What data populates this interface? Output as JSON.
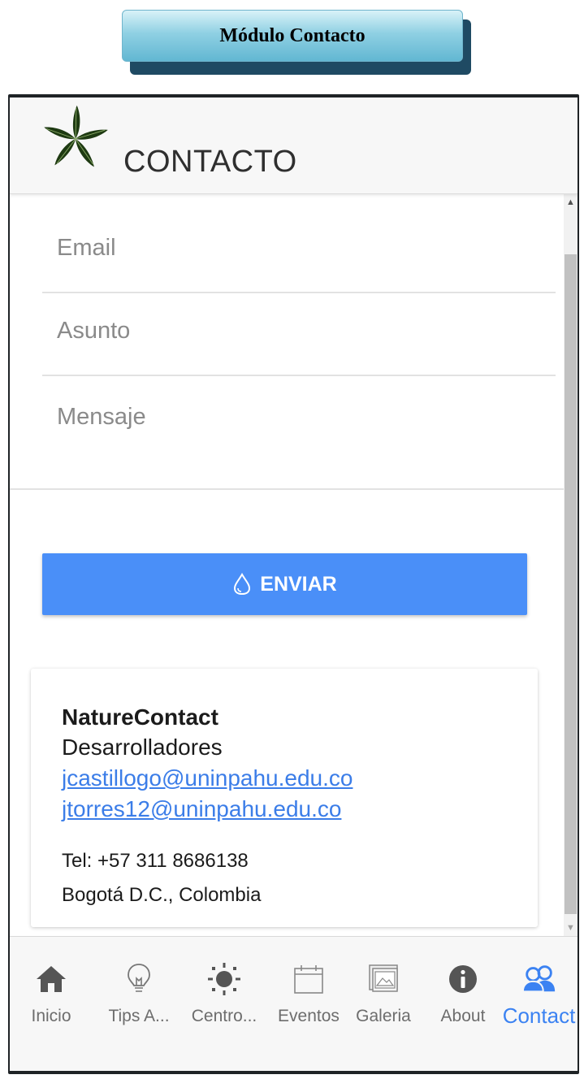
{
  "banner": {
    "title": "Módulo Contacto"
  },
  "header": {
    "title": "CONTACTO",
    "logo_icon": "leaf-star-logo"
  },
  "form": {
    "email_placeholder": "Email",
    "subject_placeholder": "Asunto",
    "message_placeholder": "Mensaje",
    "send_label": "ENVIAR",
    "send_icon": "water-drop-icon",
    "accent": "#4a8ff8"
  },
  "contact_card": {
    "name": "NatureContact",
    "role": "Desarrolladores",
    "emails": [
      "jcastillogo@uninpahu.edu.co",
      "jtorres12@uninpahu.edu.co"
    ],
    "phone": "Tel: +57 311 8686138",
    "city": "Bogotá D.C., Colombia"
  },
  "tabs": [
    {
      "label": "Inicio",
      "icon": "home-icon",
      "active": false
    },
    {
      "label": "Tips A...",
      "icon": "lightbulb-icon",
      "active": false
    },
    {
      "label": "Centro...",
      "icon": "sun-icon",
      "active": false
    },
    {
      "label": "Eventos",
      "icon": "calendar-icon",
      "active": false
    },
    {
      "label": "Galeria",
      "icon": "gallery-icon",
      "active": false
    },
    {
      "label": "About",
      "icon": "info-icon",
      "active": false
    },
    {
      "label": "Contact",
      "icon": "contacts-icon",
      "active": true
    }
  ],
  "colors": {
    "active_tab": "#3b82f2",
    "link": "#3b7de8",
    "inactive_icon": "#555555"
  }
}
